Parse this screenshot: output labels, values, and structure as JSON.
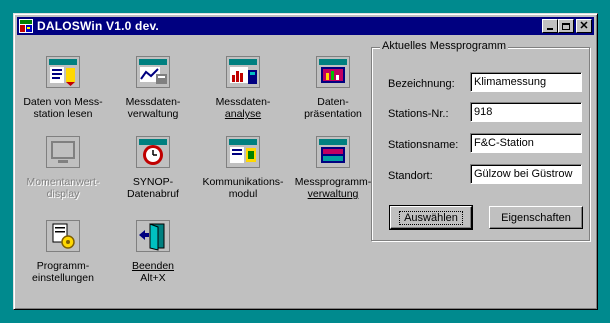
{
  "window": {
    "title": "DALOSWin V1.0 dev.",
    "titlebar_color": "#000080",
    "desktop_color": "#008a8e"
  },
  "tiles": [
    {
      "line1": "Daten von Mess-",
      "line2": "station lesen",
      "icon": "download-data-icon"
    },
    {
      "line1": "Messdaten-",
      "line2": "verwaltung",
      "icon": "data-management-icon"
    },
    {
      "line1": "Messdaten-",
      "line2": "analyse",
      "icon": "data-analysis-icon"
    },
    {
      "line1": "Daten-",
      "line2": "präsentation",
      "icon": "data-presentation-icon"
    },
    {
      "line1": "Momentanwert-",
      "line2": "display",
      "icon": "monitor-display-icon",
      "disabled": true
    },
    {
      "line1": "SYNOP-",
      "line2": "Datenabruf",
      "icon": "synop-clock-icon"
    },
    {
      "line1": "Kommunikations-",
      "line2": "modul",
      "icon": "communication-module-icon"
    },
    {
      "line1": "Messprogramm-",
      "line2": "verwaltung",
      "icon": "program-management-icon"
    },
    {
      "line1": "Programm-",
      "line2": "einstellungen",
      "icon": "program-settings-icon"
    },
    {
      "line1": "Beenden",
      "line2": "Alt+X",
      "icon": "exit-door-icon"
    }
  ],
  "panel": {
    "legend": "Aktuelles Messprogramm",
    "fields": [
      {
        "label": "Bezeichnung:",
        "value": "Klimamessung"
      },
      {
        "label": "Stations-Nr.:",
        "value": "918"
      },
      {
        "label": "Stationsname:",
        "value": "F&C-Station"
      },
      {
        "label": "Standort:",
        "value": "Gülzow bei Güstrow"
      }
    ],
    "select_button": "Auswählen",
    "properties_button": "Eigenschaften"
  }
}
